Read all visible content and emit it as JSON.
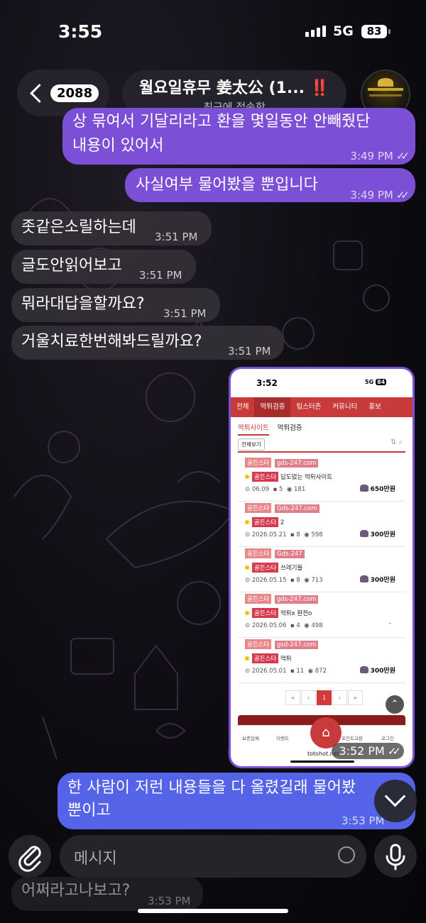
{
  "status_bar": {
    "time": "3:55",
    "network": "5G",
    "battery": "83"
  },
  "header": {
    "back_count": "2088",
    "title": "월요일휴무 姜太公 (1...",
    "title_badge": "‼️",
    "subtitle": "최근에 접속함"
  },
  "messages": [
    {
      "side": "out",
      "line1": "상 묶여서 기달리라고 환을 몇일동안 안빼줬단",
      "line2": "내용이 있어서",
      "time": "3:49 PM"
    },
    {
      "side": "out",
      "text": "사실여부 물어봤을 뿐입니다",
      "time": "3:49 PM"
    },
    {
      "side": "in",
      "text": "좃같은소릴하는데",
      "time": "3:51 PM"
    },
    {
      "side": "in",
      "text": "글도안읽어보고",
      "time": "3:51 PM"
    },
    {
      "side": "in",
      "text": "뭐라대답을할까요?",
      "time": "3:51 PM"
    },
    {
      "side": "in",
      "text": "거울치료한번해봐드릴까요?",
      "time": "3:51 PM"
    },
    {
      "side": "out",
      "line1": "한 사람이 저런 내용들을 다 올렸길래 물어봤",
      "line2": "뿐이고",
      "time": "3:53 PM"
    },
    {
      "side": "in",
      "text": "어쩌라고나보고?",
      "time": "3:53 PM"
    }
  ],
  "screenshot": {
    "time": "3:52",
    "network": "5G",
    "battery": "84",
    "nav": [
      "전체",
      "먹튀검증",
      "팁스터존",
      "커뮤니티",
      "홍보"
    ],
    "subtabs": [
      "먹튀사이트",
      "먹튀검증"
    ],
    "view_all": "전체보기",
    "posts": [
      {
        "tag": "골든스타",
        "domain": "gds-247.com",
        "title": "답도없는 먹튀사이트",
        "date": "06.09",
        "comments": "5",
        "views": "181",
        "amount": "650만원"
      },
      {
        "tag": "골든스타",
        "domain": "Gds-247.com",
        "title": "2",
        "date": "2026.05.21",
        "comments": "8",
        "views": "598",
        "amount": "300만원"
      },
      {
        "tag": "골든스타",
        "domain": "Gds-247",
        "title": "쓰레기들",
        "date": "2026.05.15",
        "comments": "8",
        "views": "713",
        "amount": "300만원"
      },
      {
        "tag": "골든스타",
        "domain": "gds-247.com",
        "title": "먹튀x 환전o",
        "date": "2026.05.06",
        "comments": "4",
        "views": "498",
        "amount": "-"
      },
      {
        "tag": "골든스타",
        "domain": "gsd-247.com",
        "title": "먹튀",
        "date": "2026.05.01",
        "comments": "11",
        "views": "872",
        "amount": "300만원"
      }
    ],
    "pager": [
      "«",
      "‹",
      "1",
      "›",
      "»"
    ],
    "bottom_nav": [
      "보증업체",
      "이벤트",
      "",
      "포인트교환",
      "로그인"
    ],
    "url": "totohot.net",
    "sent_time": "3:52 PM"
  },
  "composer": {
    "placeholder": "메시지"
  }
}
